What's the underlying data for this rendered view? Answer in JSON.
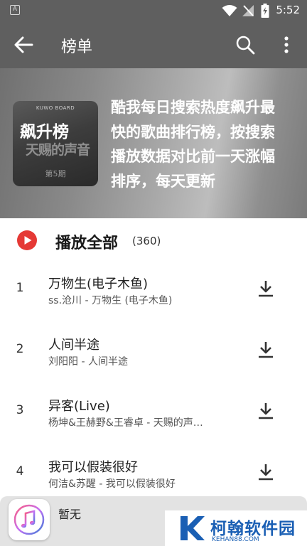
{
  "status_bar": {
    "time": "5:52",
    "left_glyph": "A"
  },
  "toolbar": {
    "title": "榜单"
  },
  "banner": {
    "cover_top": "KUWO BOARD",
    "cover_title": "飙升榜",
    "cover_art": "天赐的声音",
    "cover_episode": "第5期",
    "description": "酷我每日搜索热度飙升最快的歌曲排行榜，按搜索播放数据对比前一天涨幅排序，每天更新"
  },
  "play_all": {
    "label": "播放全部",
    "count": "(360)"
  },
  "songs": [
    {
      "rank": "1",
      "name": "万物生(电子木鱼)",
      "sub": "ss.沧川 - 万物生 (电子木鱼)"
    },
    {
      "rank": "2",
      "name": "人间半途",
      "sub": "刘阳阳 - 人间半途"
    },
    {
      "rank": "3",
      "name": "异客(Live)",
      "sub": "杨坤&王赫野&王睿卓 - 天赐的声…"
    },
    {
      "rank": "4",
      "name": "我可以假装很好",
      "sub": "何洁&苏醒 - 我可以假装很好"
    }
  ],
  "player": {
    "now_playing": "暂无"
  },
  "watermark": {
    "name": "柯翰软件园",
    "url": "KEHAN88.COM"
  },
  "colors": {
    "accent_red": "#e53935",
    "watermark_blue": "#1a5fb4"
  },
  "icons": [
    "back-arrow-icon",
    "search-icon",
    "more-vert-icon",
    "play-circle-icon",
    "download-icon",
    "music-note-icon",
    "wifi-icon",
    "no-signal-icon",
    "battery-charging-icon"
  ]
}
